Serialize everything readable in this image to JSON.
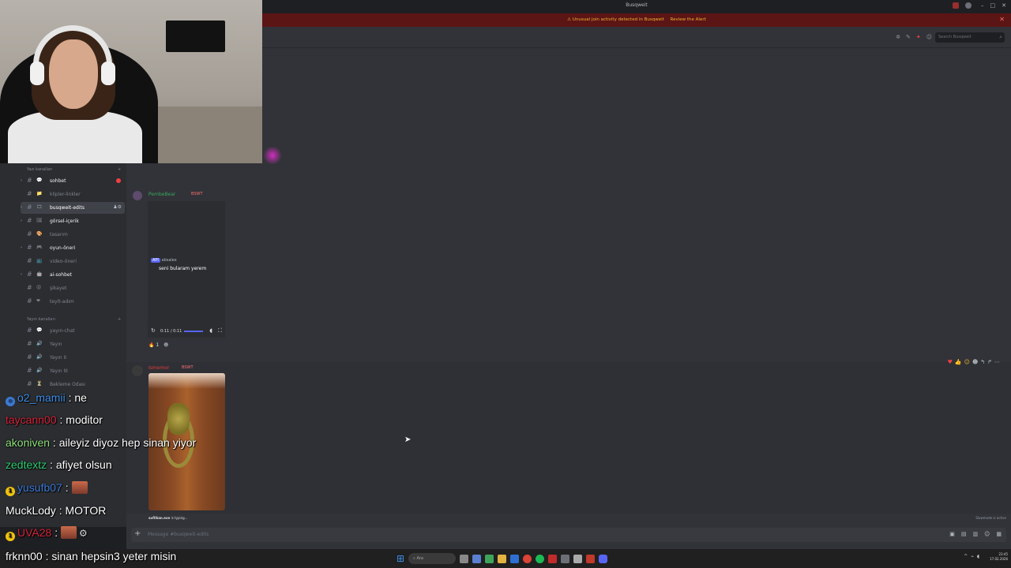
{
  "window": {
    "title": "Busqweit"
  },
  "alert": {
    "text": "Unusual join activity detected in Busqweit",
    "link": "Review the Alert"
  },
  "header": {
    "search_placeholder": "Search Busqweit"
  },
  "sidebar": {
    "categories": [
      {
        "label": "Yazı kanalları"
      },
      {
        "label": "Yayın kanalları"
      }
    ],
    "channels": [
      {
        "name": "sohbet",
        "emoji": "💬",
        "bold": true,
        "has_arrow": true,
        "unread": true
      },
      {
        "name": "klipler-linkler",
        "emoji": "📁",
        "bold": false
      },
      {
        "name": "busqweit-edits",
        "emoji": "🎞",
        "bold": true,
        "active": true,
        "has_arrow": true
      },
      {
        "name": "görsel-içerik",
        "emoji": "🖼",
        "bold": true,
        "has_arrow": true
      },
      {
        "name": "tasarım",
        "emoji": "🎨",
        "bold": false
      },
      {
        "name": "oyun-öneri",
        "emoji": "🎮",
        "bold": true,
        "has_arrow": true
      },
      {
        "name": "video-öneri",
        "emoji": "📺",
        "bold": false
      },
      {
        "name": "ai-sohbet",
        "emoji": "🤖",
        "bold": true,
        "has_arrow": true
      },
      {
        "name": "şikayet",
        "emoji": "😡",
        "bold": false
      },
      {
        "name": "teyit-adım",
        "emoji": "❤",
        "bold": false
      },
      {
        "name": "yayın-chat",
        "emoji": "💬",
        "bold": false
      },
      {
        "name": "Yayın",
        "emoji": "🔊",
        "bold": false
      },
      {
        "name": "Yayın II",
        "emoji": "🔊",
        "bold": false
      },
      {
        "name": "Yayın III",
        "emoji": "🔊",
        "bold": false
      },
      {
        "name": "Bekleme Odası",
        "emoji": "⏳",
        "bold": false
      }
    ]
  },
  "messages": [
    {
      "author": "PembeBear",
      "tag": "BSWT",
      "reply_tag": "API",
      "reply_user": "absalex",
      "reply_text": "seni bularam yerem",
      "video_time": "0:11 / 0:11",
      "reaction_count": "1"
    },
    {
      "author": "Ismemor",
      "tag": "BSWT"
    }
  ],
  "typing": {
    "who": "sufilkan.exe",
    "rest": "is typing..."
  },
  "slowmode": "Slowmode is active",
  "composer": {
    "placeholder": "Message #busqweit-edits"
  },
  "taskbar": {
    "search": "Ara",
    "time": "23:45",
    "date": "17.02.2026"
  },
  "stream_chat": [
    {
      "user": "o2_mamii",
      "color": "#3d8ee8",
      "text": "ne",
      "badge": "face"
    },
    {
      "user": "taycann00",
      "color": "#d6243a",
      "text": "moditor"
    },
    {
      "user": "akoniven",
      "color": "#8ee07a",
      "text": "aileyiz diyoz hep sinan yiyor"
    },
    {
      "user": "zedtextz",
      "color": "#2ecc71",
      "text": "afiyet olsun"
    },
    {
      "user": "yusufb07",
      "color": "#3d7bd6",
      "text": "",
      "badge": "sub",
      "emote": true
    },
    {
      "user": "MuckLody",
      "color": "#ffffff",
      "text": "MOTOR"
    },
    {
      "user": "UVA28",
      "color": "#d6243a",
      "text": "",
      "badge": "sub",
      "emote": true
    },
    {
      "user": "frknn00",
      "color": "#ffffff",
      "text": "sinan hepsin3 yeter misin"
    }
  ]
}
